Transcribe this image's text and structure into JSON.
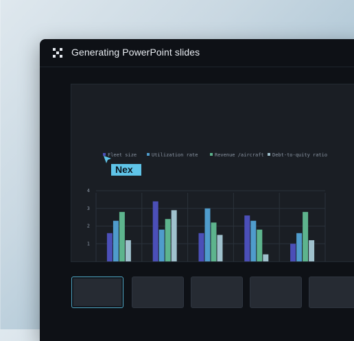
{
  "window": {
    "title": "Generating PowerPoint slides",
    "icon": "app-grid-icon"
  },
  "cursor": {
    "label": "Nex",
    "color": "#5fc4e8"
  },
  "chart_data": {
    "type": "bar",
    "categories": [
      "",
      "",
      "",
      "",
      ""
    ],
    "series": [
      {
        "name": "Fleet size",
        "color": "#4b4fb8",
        "values": [
          1.6,
          3.4,
          1.6,
          2.6,
          1.0
        ]
      },
      {
        "name": "Utilization rate",
        "color": "#4f9ccc",
        "values": [
          2.3,
          1.8,
          3.0,
          2.3,
          1.6
        ]
      },
      {
        "name": "Revenue /aircraft",
        "color": "#5db48d",
        "values": [
          2.8,
          2.4,
          2.2,
          1.8,
          2.8
        ]
      },
      {
        "name": "Debt-to-quity ratio",
        "color": "#9fc1cd",
        "values": [
          1.2,
          2.9,
          1.5,
          0.4,
          1.2
        ]
      }
    ],
    "yticks": [
      "1",
      "2",
      "3",
      "4"
    ],
    "ylim": [
      0,
      4
    ],
    "grid": true,
    "legend": "top"
  },
  "thumbnails": [
    {
      "label": "",
      "active": true
    },
    {
      "label": "",
      "active": false
    },
    {
      "label": "",
      "active": false
    },
    {
      "label": "",
      "active": false
    },
    {
      "label": "",
      "active": false
    }
  ]
}
